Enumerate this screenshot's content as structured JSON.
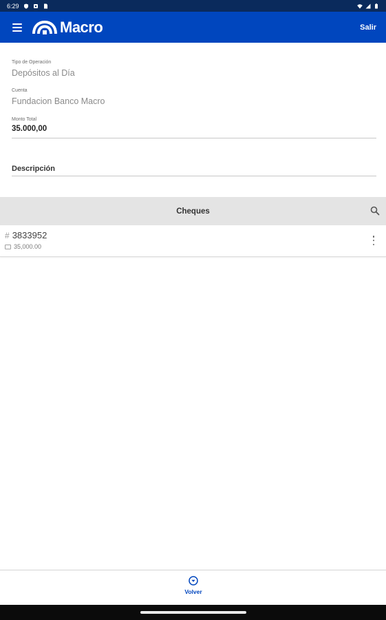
{
  "status_bar": {
    "time": "6:29"
  },
  "app_bar": {
    "brand": "Macro",
    "exit_label": "Salir",
    "brand_color": "#0046be"
  },
  "form": {
    "operation_type": {
      "label": "Tipo de Operación",
      "value": "Depósitos al Día"
    },
    "account": {
      "label": "Cuenta",
      "value": "Fundacion Banco Macro"
    },
    "total_amount": {
      "label": "Monto Total",
      "value": "35.000,00"
    },
    "description": {
      "label": "Descripción"
    }
  },
  "cheques": {
    "title": "Cheques",
    "items": [
      {
        "number": "3833952",
        "amount": "35,000.00"
      }
    ]
  },
  "bottom": {
    "back_label": "Volver"
  },
  "icons": {
    "menu": "menu-icon",
    "search": "search-icon",
    "more": "more-vert-icon",
    "back": "arrow-down-circle-icon",
    "hash": "hash-icon",
    "money": "money-icon"
  }
}
